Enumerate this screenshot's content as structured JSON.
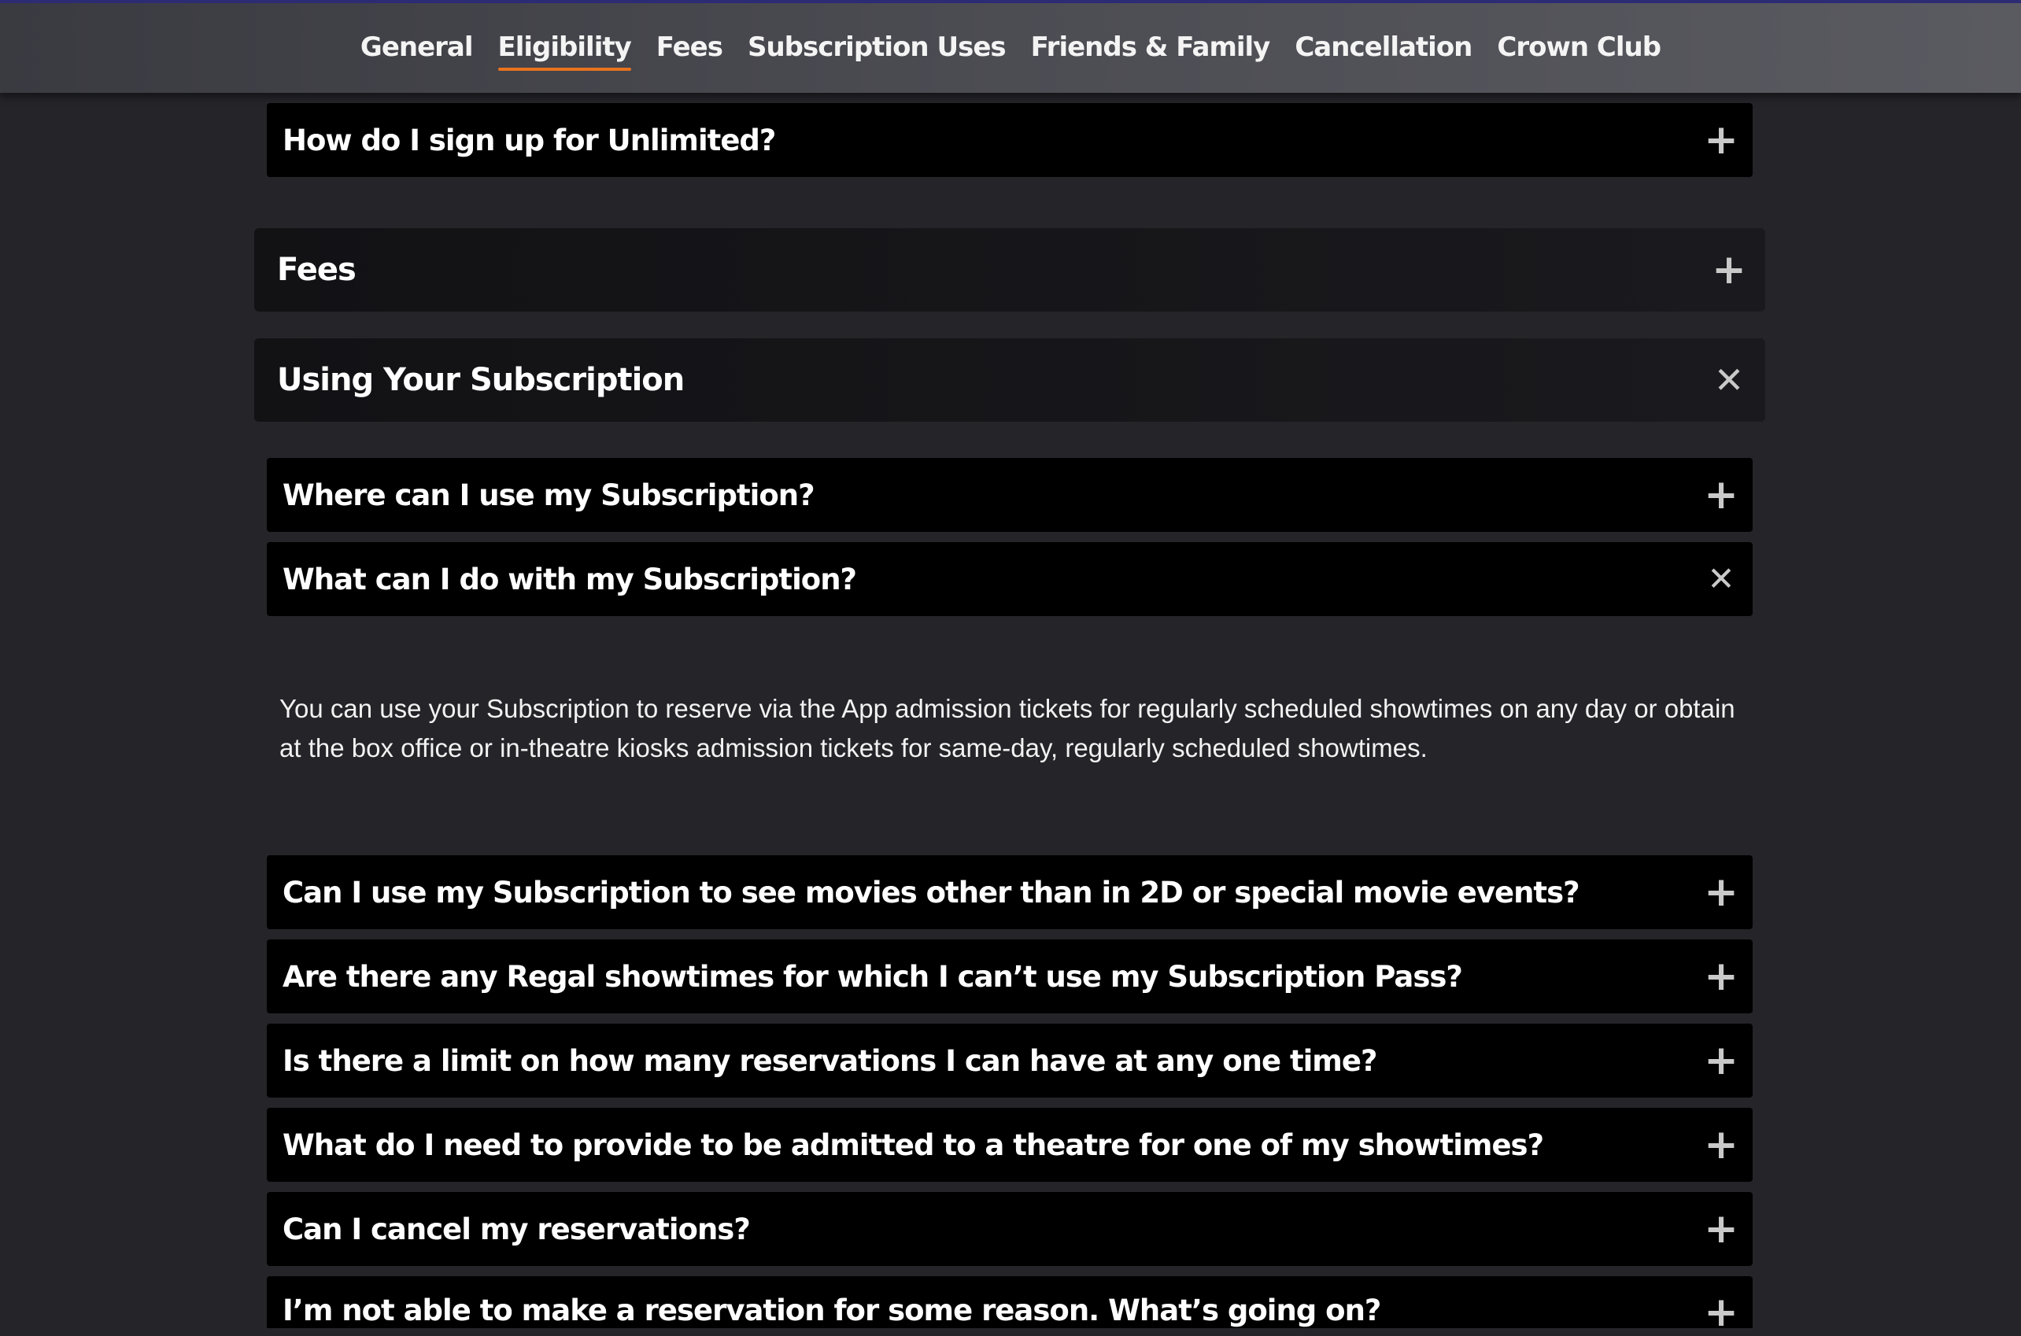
{
  "nav": {
    "tabs": [
      {
        "label": "General"
      },
      {
        "label": "Eligibility"
      },
      {
        "label": "Fees"
      },
      {
        "label": "Subscription Uses"
      },
      {
        "label": "Friends & Family"
      },
      {
        "label": "Cancellation"
      },
      {
        "label": "Crown Club"
      }
    ],
    "active": "Eligibility",
    "accent": "#e8731e"
  },
  "faq": {
    "signup_question": "How do I sign up for Unlimited?",
    "fees_section": "Fees",
    "using_section": "Using Your Subscription",
    "questions": [
      {
        "text": "Where can I use my Subscription?",
        "state": "collapsed"
      },
      {
        "text": "What can I do with my Subscription?",
        "state": "expanded"
      },
      {
        "text": "Can I use my Subscription to see movies other than in 2D or special movie events?",
        "state": "collapsed"
      },
      {
        "text": "Are there any Regal showtimes for which I can’t use my Subscription Pass?",
        "state": "collapsed"
      },
      {
        "text": "Is there a limit on how many reservations I can have at any one time?",
        "state": "collapsed"
      },
      {
        "text": "What do I need to provide to be admitted to a theatre for one of my showtimes?",
        "state": "collapsed"
      },
      {
        "text": "Can I cancel my reservations?",
        "state": "collapsed"
      },
      {
        "text": "I’m not able to make a reservation for some reason. What’s going on?",
        "state": "collapsed"
      }
    ],
    "answer": "You can use your Subscription to reserve via the App admission tickets for regularly scheduled showtimes on any day or obtain at the box office or in-theatre kiosks admission tickets for same-day, regularly scheduled showtimes.",
    "icons": {
      "expand": "plus-icon",
      "collapse": "close-icon"
    }
  }
}
